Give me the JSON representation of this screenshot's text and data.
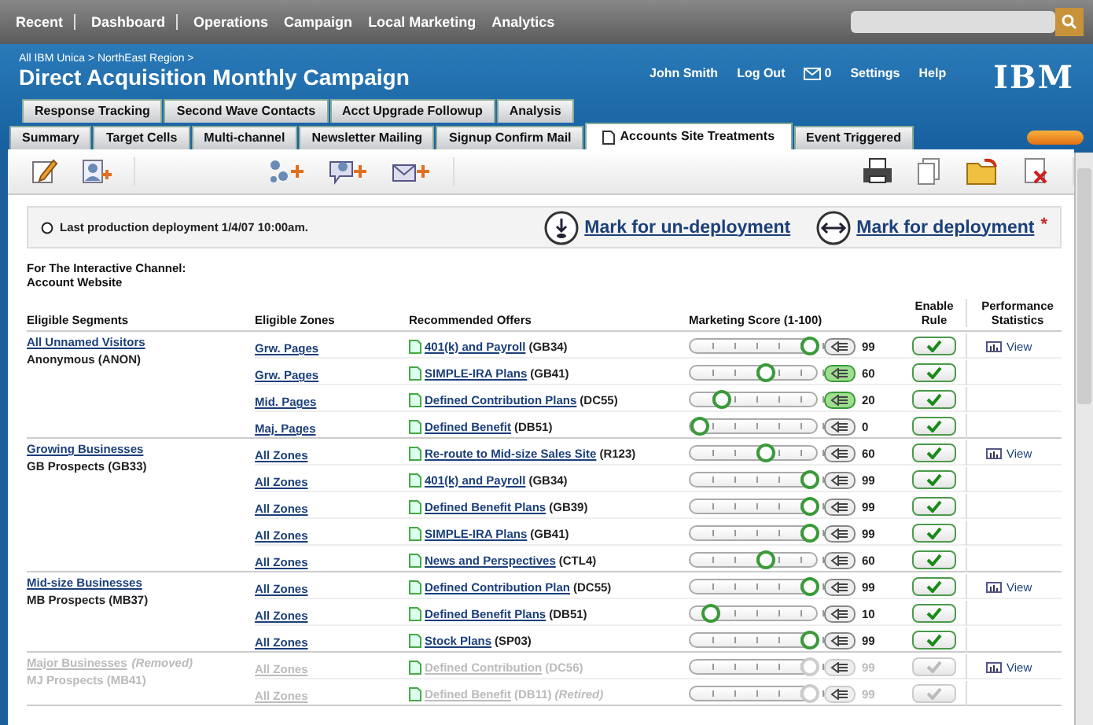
{
  "nav": {
    "items": [
      {
        "label": "Recent",
        "separator_after": true
      },
      {
        "label": "Dashboard",
        "separator_after": true
      },
      {
        "label": "Operations",
        "separator_after": false
      },
      {
        "label": "Campaign",
        "separator_after": false
      },
      {
        "label": "Local Marketing",
        "separator_after": false
      },
      {
        "label": "Analytics",
        "separator_after": false
      }
    ]
  },
  "header": {
    "breadcrumb": "All IBM Unica > NorthEast Region >",
    "title": "Direct Acquisition Monthly Campaign",
    "user": "John Smith",
    "links": [
      {
        "kind": "link",
        "label": "Log Out"
      },
      {
        "kind": "mail",
        "label": "0"
      },
      {
        "kind": "link",
        "label": "Settings"
      },
      {
        "kind": "link",
        "label": "Help"
      }
    ],
    "logo": "IBM"
  },
  "tabs": [
    [
      {
        "label": "Response Tracking",
        "selected": false
      },
      {
        "label": "Second Wave Contacts",
        "selected": false
      },
      {
        "label": "Acct Upgrade Followup",
        "selected": false
      },
      {
        "label": "Analysis",
        "selected": false
      }
    ],
    [
      {
        "label": "Summary",
        "selected": false
      },
      {
        "label": "Target Cells",
        "selected": false
      },
      {
        "label": "Multi-channel",
        "selected": false
      },
      {
        "label": "Newsletter Mailing",
        "selected": false
      },
      {
        "label": "Signup Confirm Mail",
        "selected": false
      },
      {
        "label": "Accounts Site Treatments",
        "selected": true
      },
      {
        "label": "Event Triggered",
        "selected": false
      }
    ]
  ],
  "deployment": {
    "status": "Last production deployment 1/4/07 10:00am.",
    "undeploy": "Mark for un-deployment",
    "deploy": "Mark for deployment",
    "deploy_mark": "*"
  },
  "channel": {
    "label": "For The Interactive Channel:",
    "name": "Account Website"
  },
  "columns": {
    "segments": "Eligible Segments",
    "zones": "Eligible Zones",
    "offers": "Recommended Offers",
    "score": "Marketing Score (1-100)",
    "enable": "Enable Rule",
    "performance": "Performance Statistics"
  },
  "segments": [
    {
      "name": "All Unnamed Visitors",
      "prospects": "Anonymous (ANON)",
      "disabled": false,
      "stats": "View",
      "rows": [
        {
          "zone": "Grw. Pages",
          "offer": "401(k) and Payroll",
          "code": "(GB34)",
          "level": 1,
          "score": "99",
          "override": false,
          "enabled": true
        },
        {
          "zone": "Grw. Pages",
          "offer": "SIMPLE-IRA Plans",
          "code": "(GB41)",
          "level": 0.6,
          "score": "60",
          "override": true,
          "enabled": true
        },
        {
          "zone": "Mid. Pages",
          "offer": "Defined Contribution Plans",
          "code": "(DC55)",
          "level": 0.2,
          "score": "20",
          "override": true,
          "enabled": true
        },
        {
          "zone": "Maj. Pages",
          "offer": "Defined Benefit",
          "code": "(DB51)",
          "level": 0,
          "score": "0",
          "override": false,
          "enabled": true
        }
      ]
    },
    {
      "name": "Growing Businesses",
      "prospects": "GB Prospects (GB33)",
      "disabled": false,
      "stats": "View",
      "rows": [
        {
          "zone": "All Zones",
          "offer": "Re-route to Mid-size Sales Site",
          "code": "(R123)",
          "level": 0.6,
          "score": "60",
          "override": false,
          "enabled": true
        },
        {
          "zone": "All Zones",
          "offer": "401(k) and Payroll",
          "code": "(GB34)",
          "level": 1,
          "score": "99",
          "override": false,
          "enabled": true
        },
        {
          "zone": "All Zones",
          "offer": "Defined Benefit Plans",
          "code": "(GB39)",
          "level": 1,
          "score": "99",
          "override": false,
          "enabled": true
        },
        {
          "zone": "All Zones",
          "offer": "SIMPLE-IRA Plans",
          "code": "(GB41)",
          "level": 1,
          "score": "99",
          "override": false,
          "enabled": true
        },
        {
          "zone": "All Zones",
          "offer": "News and Perspectives",
          "code": "(CTL4)",
          "level": 0.6,
          "score": "60",
          "override": false,
          "enabled": true
        }
      ]
    },
    {
      "name": "Mid-size Businesses",
      "prospects": "MB Prospects (MB37)",
      "disabled": false,
      "stats": "View",
      "rows": [
        {
          "zone": "All Zones",
          "offer": "Defined Contribution Plan",
          "code": "(DC55)",
          "level": 1,
          "score": "99",
          "override": false,
          "enabled": true
        },
        {
          "zone": "All Zones",
          "offer": "Defined Benefit Plans",
          "code": "(DB51)",
          "level": 0.1,
          "score": "10",
          "override": false,
          "enabled": true
        },
        {
          "zone": "All Zones",
          "offer": "Stock Plans",
          "code": "(SP03)",
          "level": 1,
          "score": "99",
          "override": false,
          "enabled": true
        }
      ]
    },
    {
      "name": "Major Businesses",
      "note": "(Removed)",
      "prospects": "MJ Prospects (MB41)",
      "disabled": true,
      "stats": "View",
      "rows": [
        {
          "zone": "All Zones",
          "offer": "Defined Contribution",
          "code": "(DC56)",
          "level": 1,
          "score": "99",
          "override": false,
          "enabled": true
        },
        {
          "zone": "All Zones",
          "offer": "Defined Benefit",
          "code": "(DB11)",
          "note": "(Retired)",
          "level": 1,
          "score": "99",
          "override": false,
          "enabled": true
        }
      ]
    }
  ]
}
